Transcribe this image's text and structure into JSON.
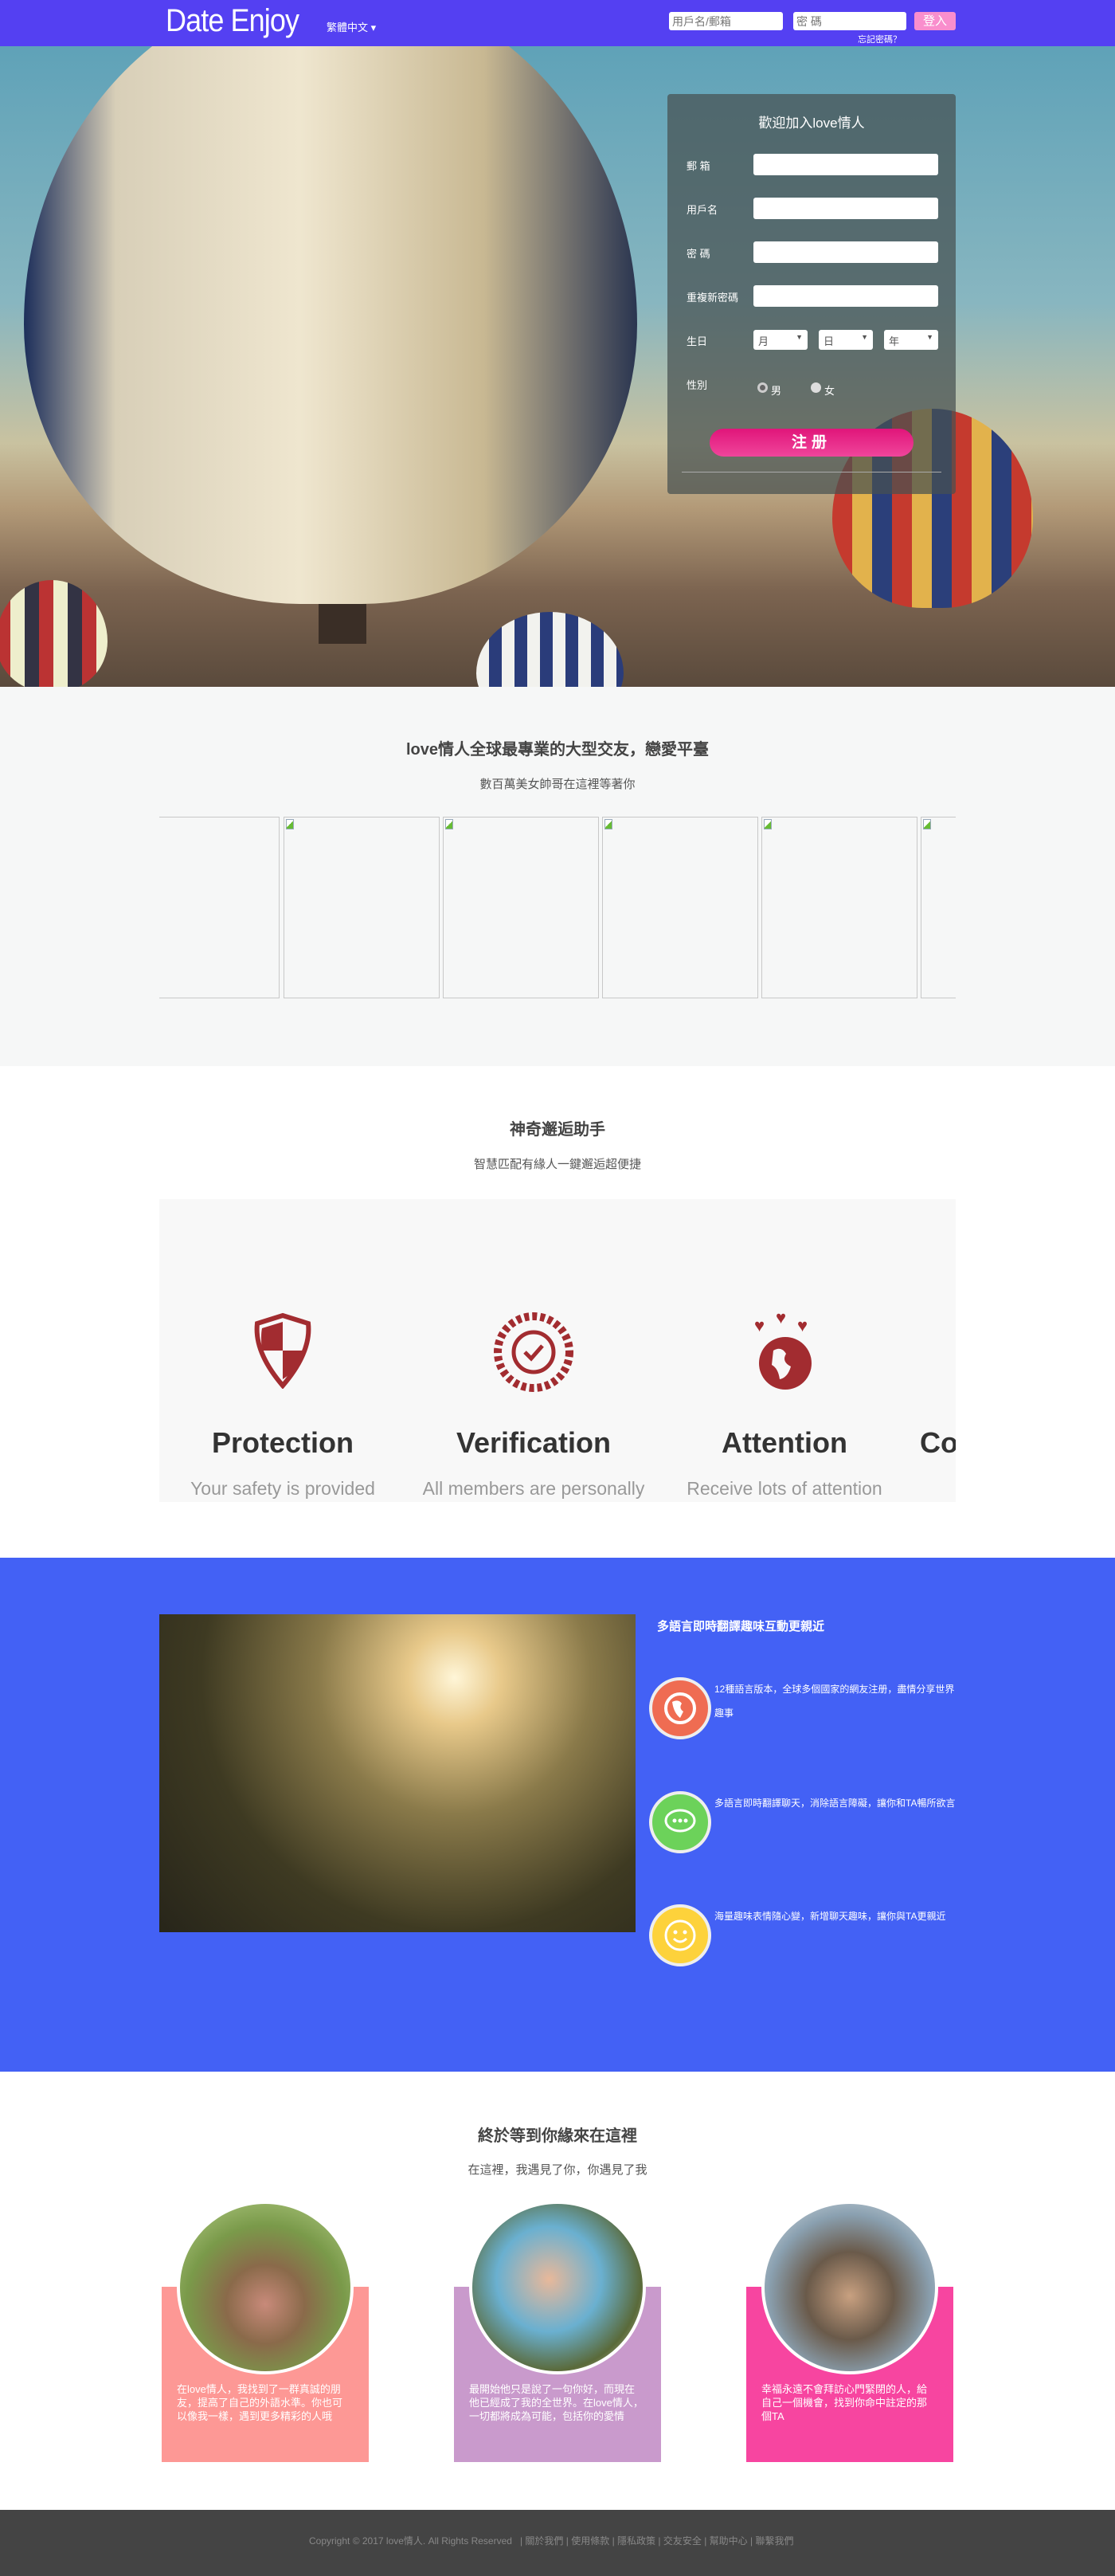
{
  "nav": {
    "logo": "Date Enjoy",
    "language": "繁體中文 ▾",
    "username_placeholder": "用戶名/郵箱",
    "password_placeholder": "密 碼",
    "login": "登入",
    "forgot": "忘記密碼？"
  },
  "register": {
    "title": "歡迎加入love情人",
    "email": "郵 箱",
    "username": "用戶名",
    "password": "密 碼",
    "repeat": "重複新密碼",
    "birthday": "生日",
    "month": "月",
    "day": "日",
    "year": "年",
    "gender": "性別",
    "male": "男",
    "female": "女",
    "submit": "注册"
  },
  "members": {
    "title": "love情人全球最專業的大型交友，戀愛平臺",
    "subtitle": "數百萬美女帥哥在這裡等著你"
  },
  "assistant": {
    "title": "神奇邂逅助手",
    "subtitle": "智慧匹配有緣人一鍵邂逅超便捷",
    "features": [
      {
        "icon": "shield-icon",
        "title": "Protection",
        "text": "Your safety is provided"
      },
      {
        "icon": "verified-member-icon",
        "title": "Verification",
        "text": "All members are personally"
      },
      {
        "icon": "globe-hearts-icon",
        "title": "Attention",
        "text": "Receive lots of attention"
      },
      {
        "title": "Co"
      }
    ]
  },
  "translate": {
    "title": "多語言即時翻譯趣味互動更親近",
    "items": [
      {
        "icon": "globe-icon",
        "color": "#ef6c52",
        "text": "12種語言版本，全球多個國家的網友注册，盡情分享世界趣事"
      },
      {
        "icon": "chat-icon",
        "color": "#6cd25a",
        "text": "多語言即時翻譯聊天，消除語言障礙，讓你和TA暢所欲言"
      },
      {
        "icon": "smile-icon",
        "color": "#fdd23b",
        "text": "海量趣味表情隨心變，新增聊天趣味，讓你與TA更親近"
      }
    ]
  },
  "stories": {
    "title": "終於等到你緣來在這裡",
    "subtitle": "在這裡，我遇見了你，你遇見了我",
    "cards": [
      {
        "color": "#fd9895",
        "text": "在love情人，我找到了一群真誠的朋友，提高了自己的外語水準。你也可以像我一樣，遇到更多精彩的人哦"
      },
      {
        "color": "#c99acc",
        "text": "最開始他只是說了一句你好，而現在他已經成了我的全世界。在love情人，一切都將成為可能，包括你的愛情"
      },
      {
        "color": "#f745a0",
        "text": "幸福永遠不會拜訪心門緊閉的人，給自己一個機會，找到你命中註定的那個TA"
      }
    ]
  },
  "footer": {
    "copyright": "Copyright © 2017 love情人. All Rights Reserved",
    "links": [
      "關於我們",
      "使用條款",
      "隱私政策",
      "交友安全",
      "幫助中心",
      "聯繫我們"
    ]
  }
}
